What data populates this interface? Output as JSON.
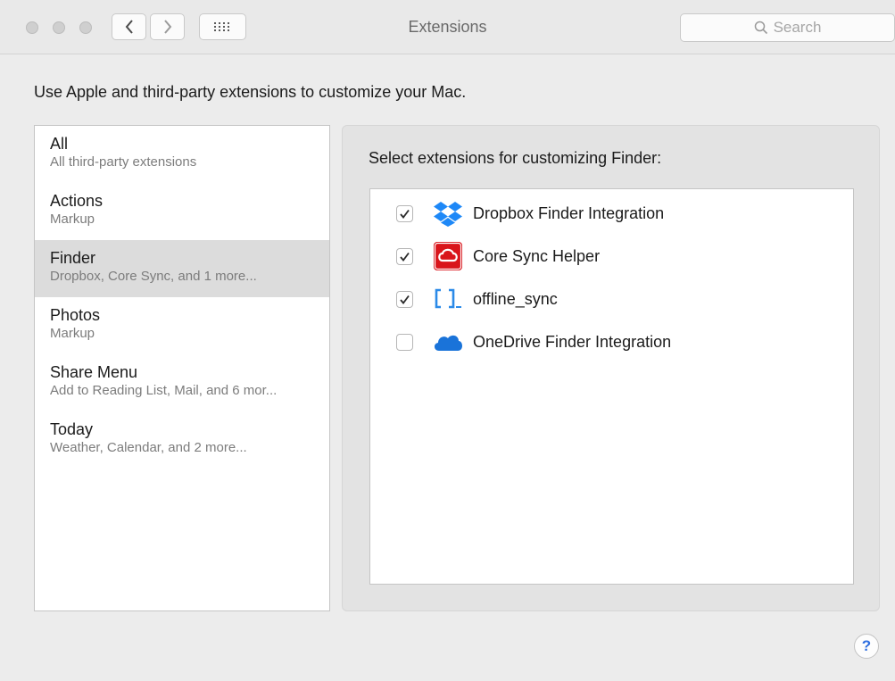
{
  "window": {
    "title": "Extensions"
  },
  "search": {
    "placeholder": "Search"
  },
  "intro": "Use Apple and third-party extensions to customize your Mac.",
  "sidebar": {
    "items": [
      {
        "title": "All",
        "subtitle": "All third-party extensions",
        "selected": false
      },
      {
        "title": "Actions",
        "subtitle": "Markup",
        "selected": false
      },
      {
        "title": "Finder",
        "subtitle": "Dropbox, Core Sync, and 1 more...",
        "selected": true
      },
      {
        "title": "Photos",
        "subtitle": "Markup",
        "selected": false
      },
      {
        "title": "Share Menu",
        "subtitle": "Add to Reading List, Mail, and 6 mor...",
        "selected": false
      },
      {
        "title": "Today",
        "subtitle": "Weather, Calendar, and 2 more...",
        "selected": false
      }
    ]
  },
  "panel": {
    "heading": "Select extensions for customizing Finder:",
    "extensions": [
      {
        "name": "Dropbox Finder Integration",
        "checked": true,
        "icon": "dropbox-icon"
      },
      {
        "name": "Core Sync Helper",
        "checked": true,
        "icon": "adobe-creative-cloud-icon"
      },
      {
        "name": "offline_sync",
        "checked": true,
        "icon": "brackets-icon"
      },
      {
        "name": "OneDrive Finder Integration",
        "checked": false,
        "icon": "onedrive-cloud-icon"
      }
    ]
  },
  "help": {
    "label": "?"
  },
  "colors": {
    "dropbox": "#1e88f7",
    "creative_cloud": "#d9151b",
    "brackets": "#2b8ae8",
    "onedrive": "#1a73d9",
    "help": "#2f6fe0"
  }
}
